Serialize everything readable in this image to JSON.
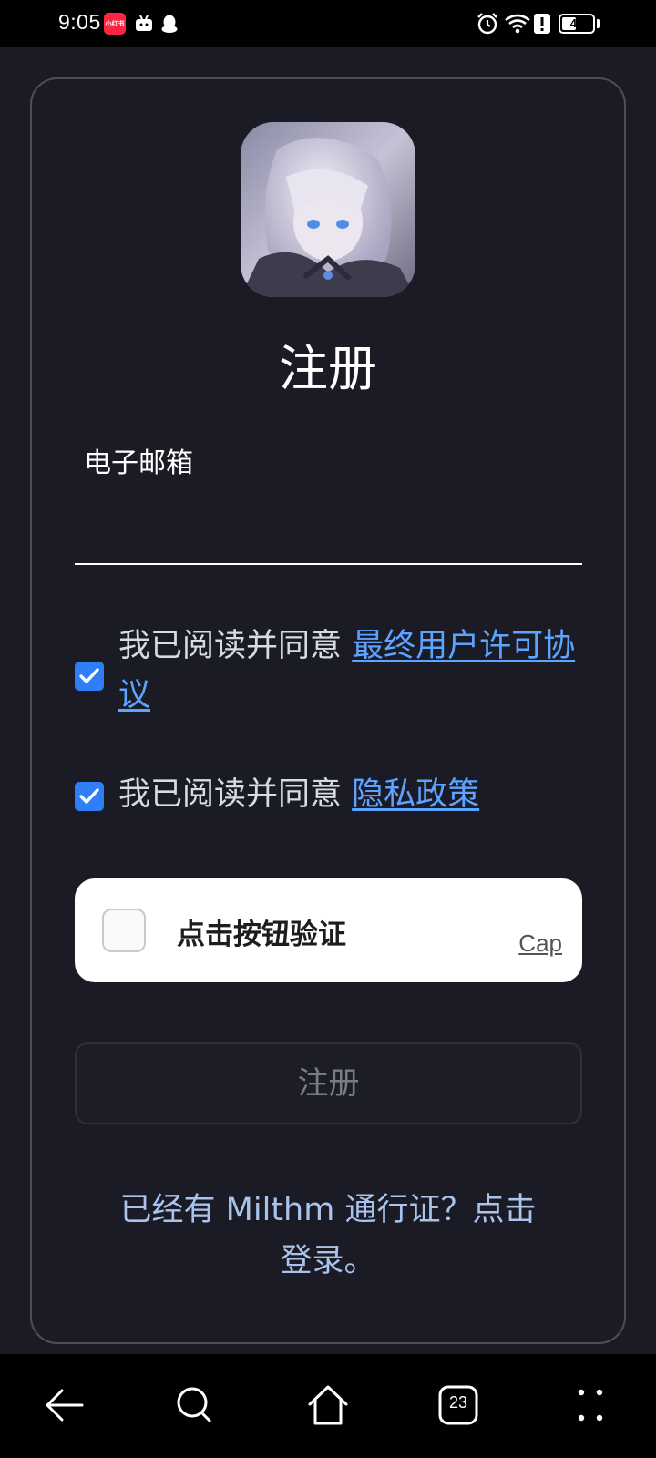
{
  "status_bar": {
    "time": "9:05",
    "battery": "47",
    "battery_level": 0.47,
    "notif_icons": [
      "xiaohongshu-icon",
      "bilibili-icon",
      "qq-icon"
    ],
    "xhs_label": "小红书",
    "system_icons": [
      "alarm-icon",
      "wifi-icon",
      "alert-icon",
      "battery-icon"
    ]
  },
  "card": {
    "title": "注册",
    "email": {
      "label": "电子邮箱",
      "value": "",
      "placeholder": ""
    },
    "agreements": [
      {
        "prefix": "我已阅读并同意 ",
        "link": "最终用户许可协议",
        "checked": true
      },
      {
        "prefix": "我已阅读并同意 ",
        "link": "隐私政策",
        "checked": true
      }
    ],
    "captcha": {
      "label": "点击按钮验证",
      "brand": "Cap",
      "checked": false
    },
    "register_button": "注册",
    "login_link": "已经有 Milthm 通行证？点击登录。"
  },
  "nav_bar": {
    "tabs_count": "23",
    "buttons": [
      "back-icon",
      "search-icon",
      "home-icon",
      "tabs-icon",
      "menu-icon"
    ]
  },
  "colors": {
    "background": "#1a1b25",
    "accent": "#2f7ef6",
    "link": "#5ea3ff",
    "login_link": "#a9c3ec"
  }
}
